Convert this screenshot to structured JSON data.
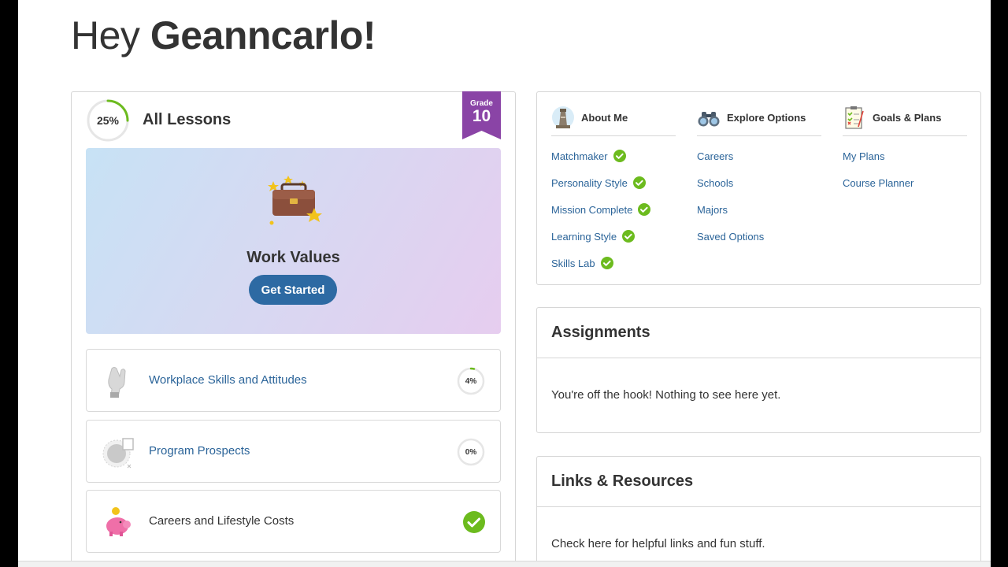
{
  "greeting": {
    "prefix": "Hey",
    "name": "Geanncarlo!"
  },
  "lessons": {
    "progress_label": "25%",
    "progress_value": 0.25,
    "title": "All Lessons",
    "grade": {
      "label": "Grade",
      "number": "10"
    },
    "featured": {
      "title": "Work Values",
      "button_label": "Get Started",
      "icon": "briefcase-icon"
    },
    "items": [
      {
        "label": "Workplace Skills and Attitudes",
        "progress_label": "4%",
        "progress_value": 0.04,
        "status": "in-progress",
        "icon": "hand-icon"
      },
      {
        "label": "Program Prospects",
        "progress_label": "0%",
        "progress_value": 0.0,
        "status": "not-started",
        "icon": "pie-chart-icon"
      },
      {
        "label": "Careers and Lifestyle Costs",
        "status": "complete",
        "icon": "piggy-bank-icon"
      }
    ]
  },
  "nav": {
    "about_me": {
      "title": "About Me",
      "icon": "lighthouse-icon",
      "links": [
        {
          "label": "Matchmaker",
          "complete": true
        },
        {
          "label": "Personality Style",
          "complete": true
        },
        {
          "label": "Mission Complete",
          "complete": true
        },
        {
          "label": "Learning Style",
          "complete": true
        },
        {
          "label": "Skills Lab",
          "complete": true
        }
      ]
    },
    "explore_options": {
      "title": "Explore Options",
      "icon": "binoculars-icon",
      "links": [
        {
          "label": "Careers"
        },
        {
          "label": "Schools"
        },
        {
          "label": "Majors"
        },
        {
          "label": "Saved Options"
        }
      ]
    },
    "goals_plans": {
      "title": "Goals & Plans",
      "icon": "checklist-icon",
      "links": [
        {
          "label": "My Plans"
        },
        {
          "label": "Course Planner"
        }
      ]
    }
  },
  "assignments": {
    "title": "Assignments",
    "message": "You're off the hook! Nothing to see here yet."
  },
  "links_resources": {
    "title": "Links & Resources",
    "message": "Check here for helpful links and fun stuff."
  },
  "colors": {
    "accent": "#2d6aa3",
    "link": "#2b6499",
    "grade_ribbon": "#8a44a6",
    "check": "#6cbb1e",
    "progress": "#6cbb1e"
  }
}
